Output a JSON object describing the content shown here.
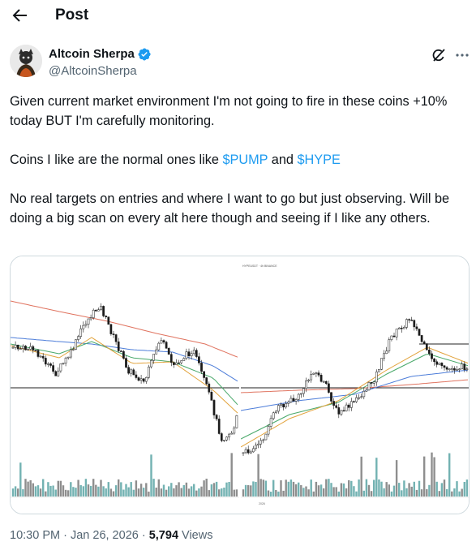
{
  "header": {
    "title": "Post",
    "back_icon": "arrow-left-icon"
  },
  "author": {
    "name": "Altcoin Sherpa",
    "handle": "@AltcoinSherpa",
    "verified": true,
    "verified_color": "#1d9bf0"
  },
  "tweet": {
    "line1": "Given current market environment I'm not going to fire in these coins +10% today BUT I'm carefully monitoring.",
    "line2_prefix": "Coins I like are the normal ones like ",
    "cashtag1": "$PUMP",
    "line2_mid": " and ",
    "cashtag2": "$HYPE",
    "line3": "No real targets on entries and where I want to go but just observing. Will be doing a big scan on every alt here though and seeing if I like any others."
  },
  "media": {
    "left_chart_alt": "Price chart",
    "right_chart_header": "HYPEUSDT · 4h BINANCE",
    "right_axis_label": "2026"
  },
  "meta": {
    "time": "10:30 PM",
    "date": "Jan 26, 2026",
    "sep": " · ",
    "views_count": "5,794",
    "views_label": " Views"
  },
  "colors": {
    "link": "#1d9bf0",
    "muted": "#536471",
    "candle": "#1a1a1a"
  }
}
